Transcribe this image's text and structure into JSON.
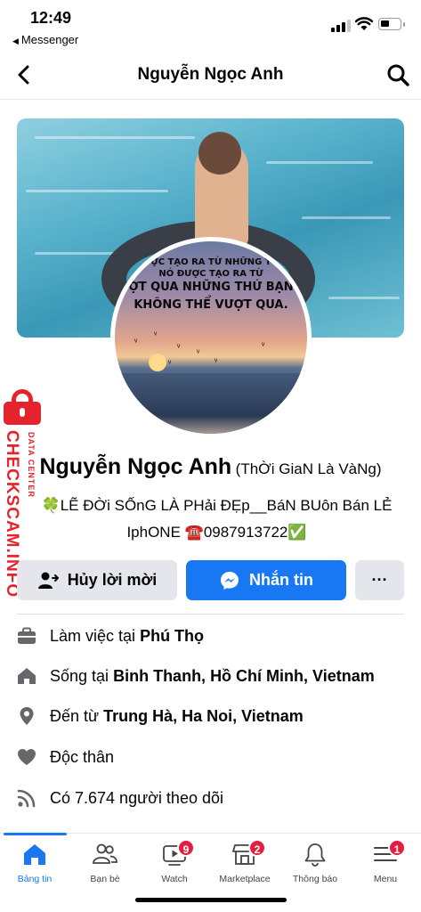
{
  "status_bar": {
    "time": "12:49",
    "back_app": "Messenger"
  },
  "header": {
    "title": "Nguyễn Ngọc Anh"
  },
  "avatar_caption": {
    "line1": "ỰC TẠO RA TỪ NHỮNG T",
    "line2": "NÓ ĐƯỢC TẠO RA TỪ",
    "line3": "ỢT QUA NHỮNG THỨ BẠN",
    "line4": "KHÔNG THỂ VƯỢT QUA."
  },
  "watermark": {
    "brand": "CHECKSCAM.INFO",
    "sub": "DATA CENTER"
  },
  "profile": {
    "name": "Nguyễn Ngọc Anh",
    "alt_name": "(ThỜi GiaN Là VàNg)",
    "bio_line1": "🍀LẼ ĐỜi SỐnG LÀ PHải ĐẸp__BáN BUôn Bán LẺ",
    "bio_line2": "IphONE ☎️0987913722✅"
  },
  "actions": {
    "cancel_label": "Hủy lời mời",
    "message_label": "Nhắn tin",
    "more_label": "···"
  },
  "details": {
    "work_prefix": "Làm việc tại",
    "work_value": "Phú Thọ",
    "lives_prefix": "Sống tại",
    "lives_value": "Binh Thanh, Hồ Chí Minh, Vietnam",
    "from_prefix": "Đến từ",
    "from_value": "Trung Hà, Ha Noi, Vietnam",
    "relationship": "Độc thân",
    "followers": "Có 7.674 người theo dõi"
  },
  "tabbar": {
    "items": [
      {
        "label": "Bảng tin",
        "icon": "home-icon",
        "active": true
      },
      {
        "label": "Bạn bè",
        "icon": "friends-icon"
      },
      {
        "label": "Watch",
        "icon": "watch-icon",
        "badge": "9"
      },
      {
        "label": "Marketplace",
        "icon": "marketplace-icon",
        "badge": "2"
      },
      {
        "label": "Thông báo",
        "icon": "bell-icon"
      },
      {
        "label": "Menu",
        "icon": "menu-icon",
        "badge": "1"
      }
    ]
  },
  "colors": {
    "brand_blue": "#1877f2",
    "badge_red": "#e41e3f",
    "watermark_red": "#e5232c",
    "button_gray": "#e4e6eb"
  }
}
